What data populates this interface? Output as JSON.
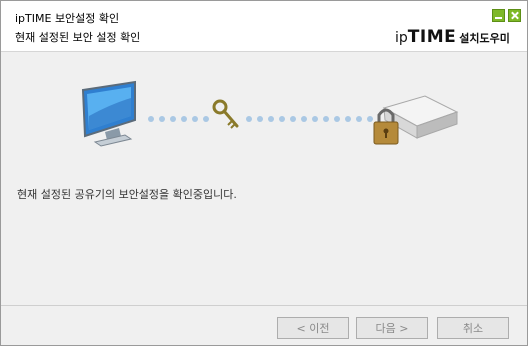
{
  "window": {
    "title": "ipTIME 보안설정 확인",
    "subtitle": "현재 설정된 보안 설정 확인"
  },
  "brand": {
    "logo_prefix": "ip",
    "logo_main": "TIME",
    "help_label": "설치도우미"
  },
  "status": {
    "message": "현재 설정된 공유기의 보안설정을 확인중입니다."
  },
  "buttons": {
    "prev_label": "< 이전",
    "next_label": "다음 >",
    "cancel_label": "취소"
  },
  "icons": {
    "computer": "monitor-icon",
    "key": "key-icon",
    "router": "router-icon",
    "lock": "padlock-icon"
  },
  "colors": {
    "accent_green": "#7fb928",
    "dots": "#aac8e4"
  }
}
